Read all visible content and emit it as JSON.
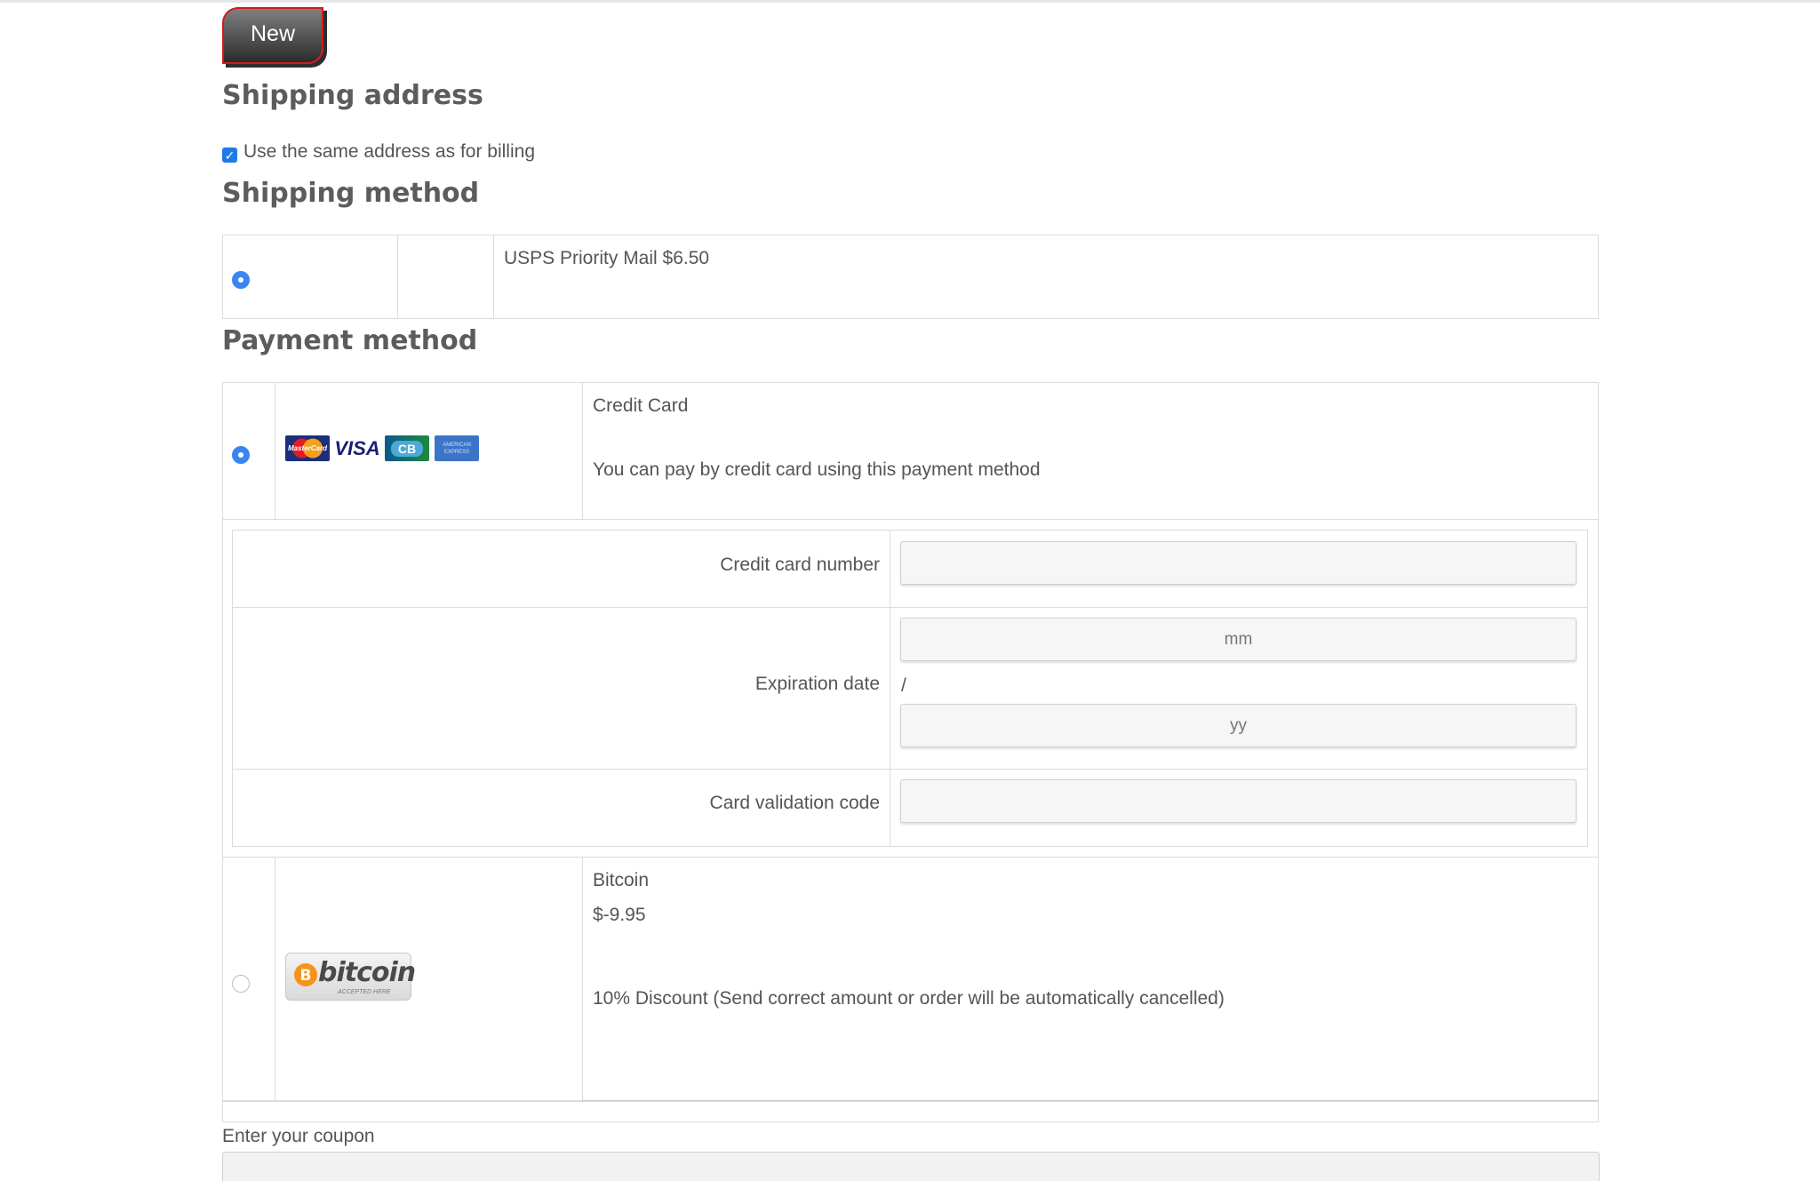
{
  "new_button": {
    "label": "New"
  },
  "shipping_address": {
    "heading": "Shipping address",
    "same_as_billing_label": "Use the same address as for billing",
    "same_as_billing_checked": true
  },
  "shipping_method": {
    "heading": "Shipping method",
    "options": [
      {
        "label": "USPS Priority Mail $6.50",
        "selected": true
      }
    ]
  },
  "payment_method": {
    "heading": "Payment method",
    "credit_card": {
      "title": "Credit Card",
      "description": "You can pay by credit card using this payment method",
      "selected": true,
      "card_icons": [
        "mastercard-icon",
        "visa-icon",
        "cb-icon",
        "american-express-icon"
      ],
      "card_icon_texts": {
        "mastercard": "MasterCard",
        "visa": "VISA",
        "cb": "CB",
        "amex": "AMERICAN EXPRESS"
      },
      "fields": {
        "number_label": "Credit card number",
        "number_value": "",
        "expiration_label": "Expiration date",
        "month_placeholder": "mm",
        "separator": "/",
        "year_placeholder": "yy",
        "cvc_label": "Card validation code",
        "cvc_value": ""
      }
    },
    "bitcoin": {
      "title": "Bitcoin",
      "price": "$-9.95",
      "description": "10% Discount (Send correct amount or order will be automatically cancelled)",
      "selected": false,
      "logo_text": "bitcoin",
      "logo_subtext": "ACCEPTED HERE"
    }
  },
  "coupon": {
    "label": "Enter your coupon",
    "value": ""
  },
  "colors": {
    "accent": "#3a86f0",
    "text": "#555555",
    "border": "#dcdcdc",
    "new_border": "#d11a1a"
  }
}
